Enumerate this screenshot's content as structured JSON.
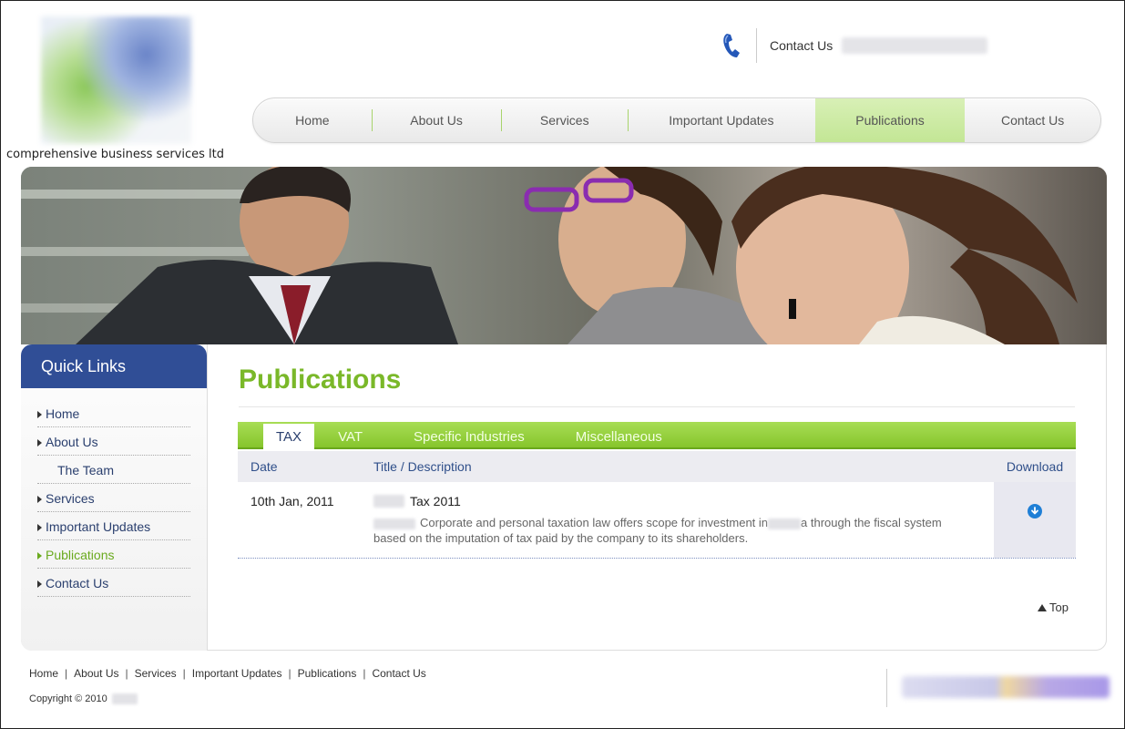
{
  "header": {
    "tagline": "comprehensive business services ltd",
    "contact_label": "Contact Us"
  },
  "nav": {
    "items": [
      {
        "label": "Home"
      },
      {
        "label": "About Us"
      },
      {
        "label": "Services"
      },
      {
        "label": "Important Updates"
      },
      {
        "label": "Publications",
        "active": true
      },
      {
        "label": "Contact Us"
      }
    ]
  },
  "sidebar": {
    "title": "Quick Links",
    "items": [
      {
        "label": "Home"
      },
      {
        "label": "About Us"
      },
      {
        "label": "The Team",
        "sub": true
      },
      {
        "label": "Services"
      },
      {
        "label": "Important Updates"
      },
      {
        "label": "Publications",
        "active": true
      },
      {
        "label": "Contact Us"
      }
    ]
  },
  "main": {
    "title": "Publications",
    "tabs": [
      {
        "label": "TAX",
        "active": true
      },
      {
        "label": "VAT"
      },
      {
        "label": "Specific Industries"
      },
      {
        "label": "Miscellaneous"
      }
    ],
    "table": {
      "headers": {
        "date": "Date",
        "title": "Title / Description",
        "download": "Download"
      },
      "rows": [
        {
          "date": "10th Jan, 2011",
          "title": "Tax 2011",
          "desc_part1": "Corporate and personal taxation law offers scope for investment in",
          "desc_part2": "a through the fiscal system based on the imputation of tax paid by the company to its shareholders."
        }
      ]
    },
    "top_link": "Top"
  },
  "footer": {
    "links": [
      "Home",
      "About Us",
      "Services",
      "Important Updates",
      "Publications",
      "Contact Us"
    ],
    "copyright": "Copyright © 2010"
  },
  "colors": {
    "brand_green": "#7ab829",
    "brand_blue": "#304e96",
    "download_blue": "#1f7fd6"
  },
  "icons": {
    "phone": "phone-icon",
    "download": "download-icon"
  }
}
